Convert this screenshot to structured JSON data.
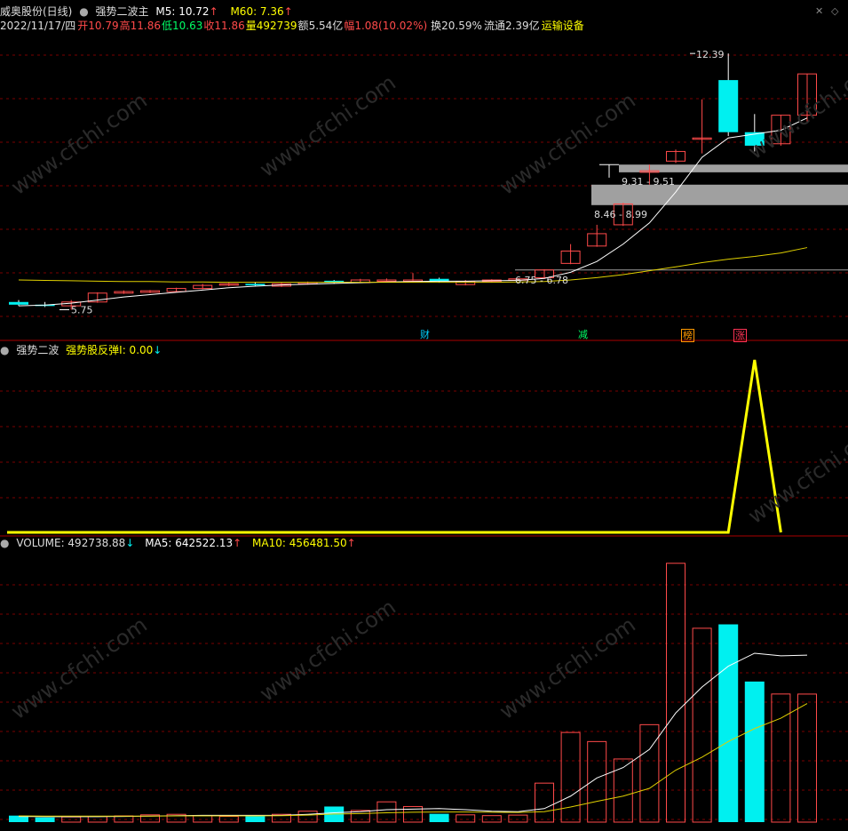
{
  "colors": {
    "up": "#ff4a4a",
    "down": "#00f0f0",
    "white": "#ffffff",
    "yellow": "#ffff00",
    "grid": "#7a0000",
    "zone": "#a0a0a0",
    "tagBlue": "#00cfff",
    "tagGreen": "#00ff66",
    "tagOrange": "#ff9900",
    "tagRed": "#ff3355",
    "info": "#dddddd"
  },
  "header": {
    "stock_name": "威奥股份(日线)",
    "indicator_name": "强势二波主",
    "m5_label": "M5: 10.72",
    "m60_label": "M60: 7.36",
    "arrow_up": "↑",
    "arrow_down": "↓",
    "close_icon": "✕",
    "expand_icon": "◇"
  },
  "info_row": {
    "date": "2022/11/17/四",
    "open_label": "开",
    "open_value": "10.79",
    "high_label": "高",
    "high_value": "11.86",
    "low_label": "低",
    "low_value": "10.63",
    "close_label": "收",
    "close_value": "11.86",
    "volume_label": "量",
    "volume_value": "492739",
    "amount_label": "额",
    "amount_value": "5.54亿",
    "change_label": "幅",
    "change_value": "1.08(10.02%)",
    "turnover_label": "换",
    "turnover_value": "20.59%",
    "float_label": "流通",
    "float_value": "2.39亿",
    "sector": "运输设备"
  },
  "annotations": {
    "high_price": "12.39",
    "low_price": "5.75",
    "zone1": "9.31 - 9.51",
    "zone2": "8.46 - 8.99",
    "zone3": "6.75 - 6.78"
  },
  "event_tags": [
    "财",
    "减",
    "榜",
    "涨"
  ],
  "sub1": {
    "title": "强势二波",
    "label": "强势股反弹I: 0.00"
  },
  "volume": {
    "label": "VOLUME: 492738.88",
    "ma5": "MA5: 642522.13",
    "ma10": "MA10: 456481.50"
  },
  "chart_data": {
    "type": "candlestick",
    "ylim": [
      5.3,
      12.9
    ],
    "candles": [
      [
        5.95,
        5.88,
        6.0,
        5.85
      ],
      [
        5.88,
        5.85,
        5.95,
        5.82
      ],
      [
        5.85,
        5.95,
        6.0,
        5.75
      ],
      [
        5.95,
        6.18,
        6.2,
        5.93
      ],
      [
        6.18,
        6.22,
        6.25,
        6.16
      ],
      [
        6.2,
        6.24,
        6.26,
        6.18
      ],
      [
        6.22,
        6.3,
        6.32,
        6.2
      ],
      [
        6.3,
        6.38,
        6.42,
        6.28
      ],
      [
        6.4,
        6.42,
        6.45,
        6.36
      ],
      [
        6.42,
        6.38,
        6.46,
        6.35
      ],
      [
        6.36,
        6.42,
        6.45,
        6.34
      ],
      [
        6.42,
        6.45,
        6.48,
        6.4
      ],
      [
        6.5,
        6.45,
        6.52,
        6.42
      ],
      [
        6.45,
        6.52,
        6.55,
        6.44
      ],
      [
        6.52,
        6.52,
        6.56,
        6.5
      ],
      [
        6.52,
        6.52,
        6.7,
        6.5
      ],
      [
        6.55,
        6.48,
        6.58,
        6.45
      ],
      [
        6.4,
        6.48,
        6.52,
        6.38
      ],
      [
        6.48,
        6.52,
        6.54,
        6.46
      ],
      [
        6.52,
        6.55,
        6.56,
        6.5
      ],
      [
        6.58,
        6.78,
        6.8,
        6.55
      ],
      [
        6.95,
        7.27,
        7.45,
        6.93
      ],
      [
        7.4,
        7.72,
        7.95,
        7.38
      ],
      [
        7.95,
        8.49,
        8.52,
        7.92
      ],
      [
        9.31,
        9.35,
        9.51,
        8.99
      ],
      [
        9.6,
        9.85,
        9.9,
        9.55
      ],
      [
        10.2,
        10.2,
        11.2,
        9.8
      ],
      [
        11.7,
        10.35,
        12.39,
        10.25
      ],
      [
        10.35,
        10.0,
        10.82,
        9.85
      ],
      [
        10.05,
        10.79,
        10.8,
        10.0
      ],
      [
        10.79,
        11.86,
        11.86,
        10.63
      ]
    ],
    "ma_white": [
      5.85,
      5.87,
      5.92,
      6.0,
      6.08,
      6.14,
      6.2,
      6.26,
      6.32,
      6.36,
      6.39,
      6.41,
      6.43,
      6.45,
      6.47,
      6.48,
      6.49,
      6.49,
      6.5,
      6.51,
      6.56,
      6.72,
      7.0,
      7.45,
      8.0,
      8.8,
      9.7,
      10.2,
      10.3,
      10.4,
      10.72
    ],
    "ma_yellow": [
      6.52,
      6.51,
      6.5,
      6.49,
      6.48,
      6.48,
      6.47,
      6.47,
      6.46,
      6.46,
      6.46,
      6.46,
      6.46,
      6.46,
      6.46,
      6.46,
      6.46,
      6.46,
      6.46,
      6.47,
      6.48,
      6.52,
      6.58,
      6.66,
      6.76,
      6.86,
      6.97,
      7.06,
      7.13,
      7.22,
      7.36
    ],
    "indicator_values": [
      0,
      0,
      0,
      0,
      0,
      0,
      0,
      0,
      0,
      0,
      0,
      0,
      0,
      0,
      0,
      0,
      0,
      0,
      0,
      0,
      0,
      0,
      0,
      0,
      0,
      0,
      0,
      0,
      1,
      0
    ],
    "volumes": [
      25000,
      18000,
      20000,
      22000,
      24000,
      28000,
      30000,
      25000,
      22000,
      25000,
      30000,
      42000,
      60000,
      45000,
      78000,
      60000,
      32000,
      28000,
      25000,
      27000,
      150000,
      345000,
      310000,
      243000,
      375000,
      996000,
      746000,
      761000,
      541000,
      493000,
      492739
    ],
    "vol_ma5": [
      22000,
      21000,
      21000,
      21000,
      22000,
      23000,
      25000,
      26000,
      26000,
      26000,
      26000,
      30000,
      36000,
      40000,
      48000,
      50000,
      52000,
      48000,
      42000,
      40000,
      52000,
      100000,
      170000,
      210000,
      280000,
      420000,
      520000,
      600000,
      650000,
      640000,
      642522
    ],
    "vol_ma10": [
      24000,
      23000,
      23000,
      23000,
      23000,
      23000,
      24000,
      24000,
      24000,
      24000,
      25000,
      27000,
      31000,
      33000,
      36000,
      38000,
      39000,
      39000,
      38000,
      37000,
      40000,
      58000,
      80000,
      100000,
      130000,
      200000,
      250000,
      310000,
      360000,
      400000,
      456481
    ],
    "vol_ylim": [
      0,
      1050000
    ]
  }
}
